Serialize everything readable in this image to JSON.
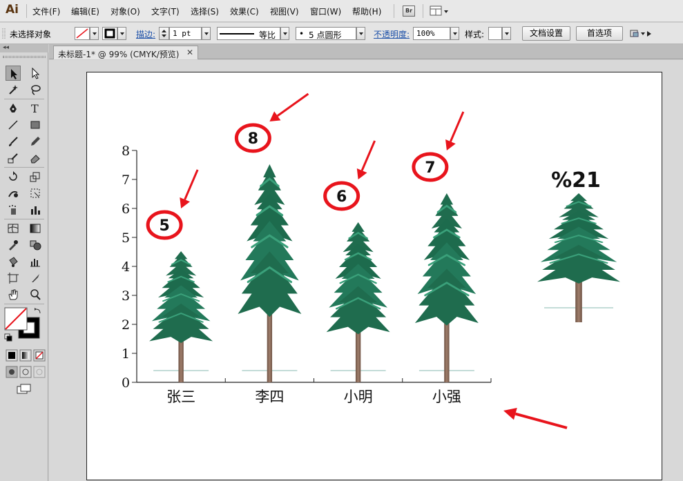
{
  "app": {
    "logo": "Ai",
    "menu": [
      "文件(F)",
      "编辑(E)",
      "对象(O)",
      "文字(T)",
      "选择(S)",
      "效果(C)",
      "视图(V)",
      "窗口(W)",
      "帮助(H)"
    ],
    "bridge_label": "Br"
  },
  "control_bar": {
    "selection_status": "未选择对象",
    "stroke_label": "描边:",
    "stroke_weight": "1 pt",
    "stroke_profile": "等比",
    "brush_label": "5 点圆形",
    "opacity_label": "不透明度:",
    "opacity_value": "100%",
    "style_label": "样式:",
    "document_setup_button": "文档设置",
    "preferences_button": "首选项"
  },
  "document": {
    "tab_title": "未标题-1* @ 99% (CMYK/预览)",
    "tab_close": "✕"
  },
  "colors": {
    "tree_dark": "#1d6b4d",
    "tree_mid": "#2b8a63",
    "trunk": "#8a6b5a",
    "annotation_red": "#e8141c",
    "ground_line": "#9fc8c0"
  },
  "chart_data": {
    "type": "bar",
    "style": "pictograph (tree images as bars)",
    "categories": [
      "张三",
      "李四",
      "小明",
      "小强"
    ],
    "values": [
      5,
      8,
      6,
      7
    ],
    "value_labels": [
      "5",
      "8",
      "6",
      "7"
    ],
    "y_ticks": [
      "0",
      "1",
      "2",
      "3",
      "4",
      "5",
      "6",
      "7",
      "8"
    ],
    "ylim": [
      0,
      8
    ],
    "legend_text": "%21",
    "title": "",
    "xlabel": "",
    "ylabel": ""
  }
}
